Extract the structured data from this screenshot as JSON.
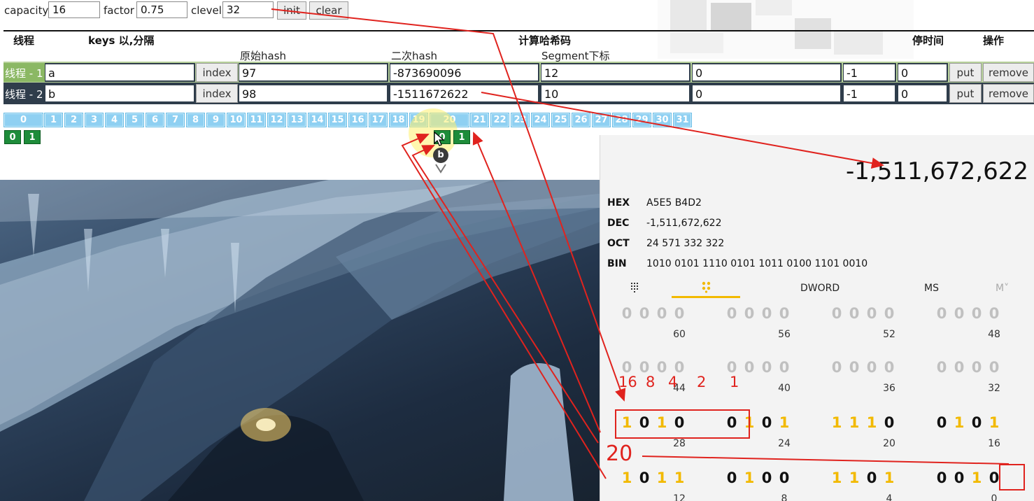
{
  "config": {
    "capacity_label": "capacity",
    "capacity_value": "16",
    "factor_label": "factor",
    "factor_value": "0.75",
    "clevel_label": "clevel",
    "clevel_value": "32",
    "init_label": "init",
    "clear_label": "clear"
  },
  "table": {
    "headers": {
      "thread": "线程",
      "keys": "keys 以,分隔",
      "hash_group": "计算哈希码",
      "pause_time": "停时间",
      "ops": "操作"
    },
    "subheaders": {
      "orig_hash": "原始hash",
      "second_hash": "二次hash",
      "segment_index": "Segment下标"
    },
    "rows": [
      {
        "tag": "线程 - 1",
        "key": "a",
        "index_label": "index",
        "orig_hash": "97",
        "second_hash": "-873690096",
        "segment_index": "12",
        "col_e": "0",
        "col_f": "-1",
        "col_g": "0",
        "put_label": "put",
        "remove_label": "remove"
      },
      {
        "tag": "线程 - 2",
        "key": "b",
        "index_label": "index",
        "orig_hash": "98",
        "second_hash": "-1511672622",
        "segment_index": "10",
        "col_e": "0",
        "col_f": "-1",
        "col_g": "0",
        "put_label": "put",
        "remove_label": "remove"
      }
    ]
  },
  "segments": {
    "labels": [
      "0",
      "1",
      "2",
      "3",
      "4",
      "5",
      "6",
      "7",
      "8",
      "9",
      "10",
      "11",
      "12",
      "13",
      "14",
      "15",
      "16",
      "17",
      "18",
      "19",
      "20",
      "21",
      "22",
      "23",
      "24",
      "25",
      "26",
      "27",
      "28",
      "29",
      "30",
      "31"
    ],
    "seg0_nodes": [
      "0",
      "1"
    ],
    "seg20_nodes": [
      "0",
      "1"
    ],
    "marker": "b"
  },
  "calculator": {
    "display": "-1,511,672,622",
    "bases": [
      {
        "label": "HEX",
        "value": "A5E5 B4D2"
      },
      {
        "label": "DEC",
        "value": "-1,511,672,622"
      },
      {
        "label": "OCT",
        "value": "24 571 332 322"
      },
      {
        "label": "BIN",
        "value": "1010 0101 1110 0101 1011 0100 1101 0010"
      }
    ],
    "tabs": {
      "word_size": "DWORD",
      "memory": "MS",
      "memory_list": "M˅"
    },
    "rows": [
      {
        "bits": "0000000000000000",
        "labels": [
          "60",
          "56",
          "52",
          "48"
        ],
        "dim": true
      },
      {
        "bits": "0000000000000000",
        "labels": [
          "44",
          "40",
          "36",
          "32"
        ],
        "dim": true
      },
      {
        "bits": "1010010111100101",
        "labels": [
          "28",
          "24",
          "20",
          "16"
        ],
        "dim": false
      },
      {
        "bits": "1011010011010010",
        "labels": [
          "12",
          "8",
          "4",
          "0"
        ],
        "dim": false
      }
    ]
  },
  "annotations": {
    "weights": [
      "16",
      "8",
      "4",
      "2",
      "1"
    ],
    "result": "20"
  },
  "colors": {
    "accent_red": "#e0231e",
    "segment_blue": "#8fd0f2",
    "node_green": "#1e8c3a",
    "bit_one": "#f2b900"
  }
}
